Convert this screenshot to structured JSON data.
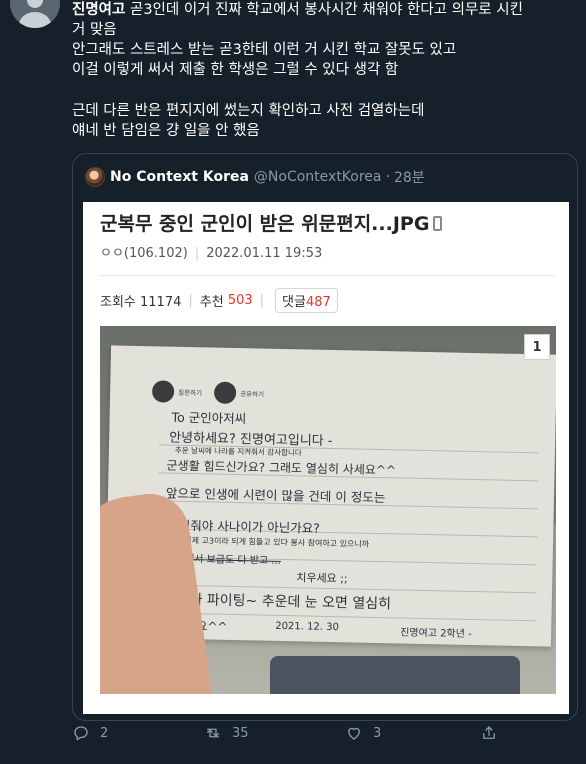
{
  "tweet": {
    "author": "진명여고",
    "line1_rest": " 곧3인데 이거 진짜 학교에서 봉사시간 채워야 한다고 의무로 시킨",
    "line2": "거 맞음",
    "line3": "안그래도 스트레스 받는 곧3한테 이런 거 시킨 학교 잘못도 있고",
    "line4": "이걸 이렇게 써서 제출 한 학생은 그럴 수 있다 생각 함",
    "line5": "근데 다른 반은 편지지에 썼는지 확인하고 사전 검열하는데",
    "line6": "얘네 반 담임은 걍 일을 안 했음"
  },
  "quote": {
    "name": "No Context Korea",
    "handle": "@NoContextKorea",
    "dot": "·",
    "time": "28분"
  },
  "media": {
    "title": "군복무 중인 군인이 받은 위문편지...JPG",
    "author_meta": "ㅇㅇ(106.102)",
    "date": "2022.01.11 19:53",
    "views_label": "조회수 11174",
    "recommend_label": "추천",
    "recommend_value": "503",
    "comments_label": "댓글",
    "comments_value": "487",
    "photo_index": "1",
    "letter": {
      "icon1_label": "질문하기",
      "icon2_label": "공유하기",
      "lines": [
        "To 군인아저씨",
        "안녕하세요? 진명여고입니다 -",
        "추운 날씨에 나라를 지켜줘서 감사합니다",
        "군생활 힘드신가요? 그래도 열심히 사세요^^",
        "앞으로 인생에 시련이 많을 건데 이 정도는",
        "이겨줘야 사나이가 아닌가요?",
        "저도 이제 고3이라 되게 힘들고 있다 봉사 참여하고 있으니까",
        "군대에서 보급도 다 받고 ...",
        "치우세요 ;;",
        "그니까 파이팅~ 추운데 눈 오면 열심히",
        "치우세요^^",
        "2021. 12. 30",
        "진명여고 2학년 -"
      ]
    }
  },
  "actions": {
    "reply_count": "2",
    "retweet_count": "35",
    "like_count": "3"
  },
  "colors": {
    "background": "#15202b",
    "border": "#38444d",
    "muted": "#8899a6",
    "accent_red": "#e1362b"
  },
  "icons": [
    "reply-icon",
    "retweet-icon",
    "like-icon",
    "share-icon",
    "phone-icon"
  ]
}
